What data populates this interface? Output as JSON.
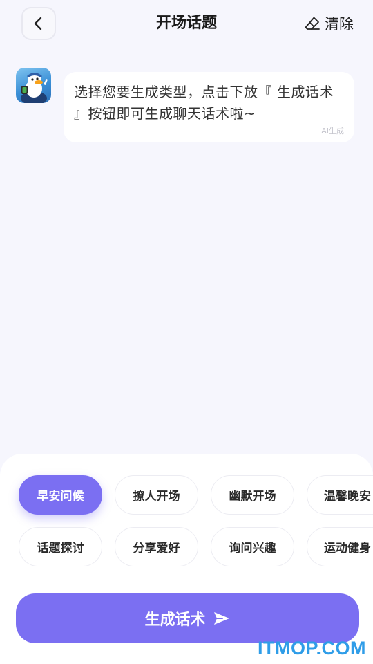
{
  "header": {
    "title": "开场话题",
    "back_icon": "chevron-left-icon",
    "clear_icon": "eraser-icon",
    "clear_label": "清除"
  },
  "chat": {
    "avatar_icon": "duck-mascot-avatar",
    "message": "选择您要生成类型，点击下放『 生成话术 』按钮即可生成聊天话术啦~",
    "ai_tag": "AI生成"
  },
  "topics": {
    "selected": "早安问候",
    "row1": [
      "早安问候",
      "撩人开场",
      "幽默开场",
      "温馨晚安"
    ],
    "row2": [
      "话题探讨",
      "分享爱好",
      "询问兴趣",
      "运动健身"
    ]
  },
  "generate": {
    "label": "生成话术",
    "icon": "send-icon"
  },
  "watermark": "ITMOP.COM",
  "colors": {
    "accent": "#7b6ff2",
    "background": "#f6f6fd",
    "watermark": "#2f9de8"
  }
}
